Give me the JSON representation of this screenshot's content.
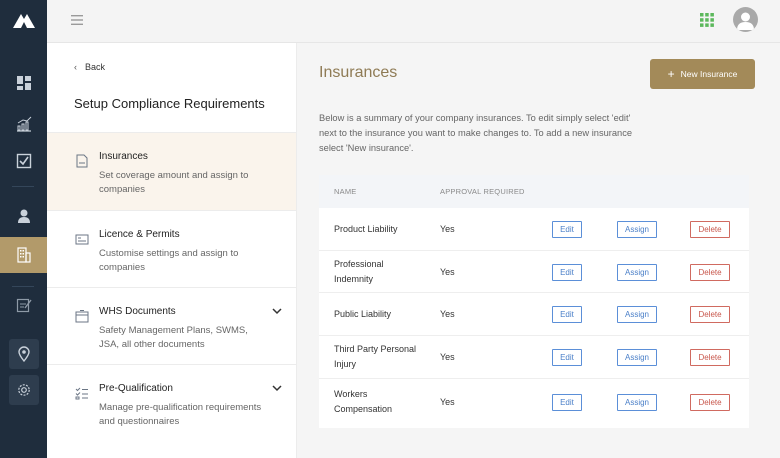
{
  "rail": {
    "icons": [
      "logo-icon",
      "dashboard-icon",
      "chart-icon",
      "checkbox-icon",
      "user-icon",
      "building-icon",
      "edit-icon",
      "location-icon",
      "settings-icon"
    ]
  },
  "topbar": {
    "menu_icon": "hamburger-icon",
    "apps_icon": "apps-grid-icon",
    "avatar_icon": "user-avatar-icon"
  },
  "colors": {
    "rail_bg": "#1f2d3d",
    "accent": "#a38a59",
    "active_rail": "#b29a6a",
    "edit_blue": "#4a7fc8",
    "delete_red": "#c8574c"
  },
  "sidebar": {
    "back_label": "Back",
    "title": "Setup Compliance Requirements",
    "items": [
      {
        "title": "Insurances",
        "desc": "Set coverage amount and assign to companies",
        "icon": "document-icon"
      },
      {
        "title": "Licence & Permits",
        "desc": "Customise settings and assign to companies",
        "icon": "id-card-icon"
      },
      {
        "title": "WHS Documents",
        "desc": "Safety Management Plans, SWMS, JSA, all other documents",
        "icon": "briefcase-icon"
      },
      {
        "title": "Pre-Qualification",
        "desc": "Manage pre-qualification requirements and questionnaires",
        "icon": "checklist-icon"
      }
    ]
  },
  "main": {
    "title": "Insurances",
    "new_button": "New Insurance",
    "intro": "Below is a summary of your company insurances. To edit simply select 'edit' next to the insurance you want to make changes to. To add a new insurance select 'New insurance'.",
    "table": {
      "headers": {
        "name": "NAME",
        "approval": "APPROVAL REQUIRED"
      },
      "rows": [
        {
          "name": "Product Liability",
          "approval": "Yes"
        },
        {
          "name": "Professional Indemnity",
          "approval": "Yes"
        },
        {
          "name": "Public Liability",
          "approval": "Yes"
        },
        {
          "name": "Third Party Personal Injury",
          "approval": "Yes"
        },
        {
          "name": "Workers Compensation",
          "approval": "Yes"
        }
      ],
      "actions": {
        "edit": "Edit",
        "assign": "Assign",
        "delete": "Delete"
      }
    }
  }
}
